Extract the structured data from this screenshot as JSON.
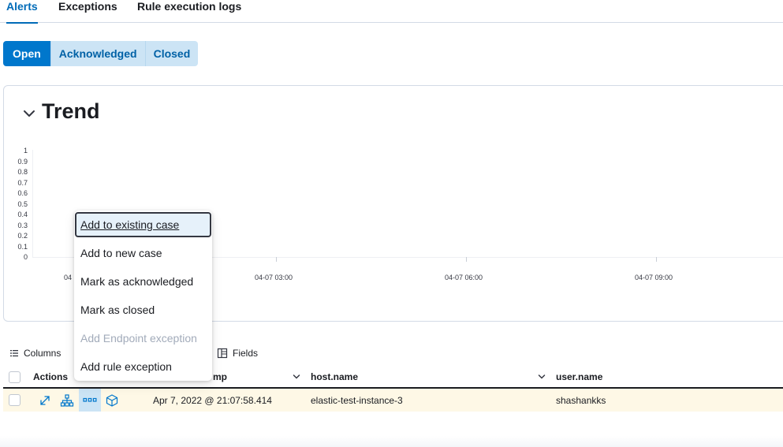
{
  "tabs": [
    {
      "label": "Alerts",
      "active": true
    },
    {
      "label": "Exceptions",
      "active": false
    },
    {
      "label": "Rule execution logs",
      "active": false
    }
  ],
  "status_filters": [
    {
      "label": "Open",
      "active": true
    },
    {
      "label": "Acknowledged",
      "active": false
    },
    {
      "label": "Closed",
      "active": false
    }
  ],
  "trend": {
    "title": "Trend"
  },
  "chart_data": {
    "type": "bar",
    "title": "",
    "xlabel": "",
    "ylabel": "",
    "ylim": [
      0,
      1
    ],
    "y_ticks": [
      "1",
      "0.9",
      "0.8",
      "0.7",
      "0.6",
      "0.5",
      "0.4",
      "0.3",
      "0.2",
      "0.1",
      "0"
    ],
    "x_ticks": [
      "04-07 00:00",
      "04-07 03:00",
      "04-07 06:00",
      "04-07 09:00"
    ],
    "x_ticks_visible_text": [
      "04",
      "04-07 03:00",
      "04-07 06:00",
      "04-07 09:00"
    ],
    "series": []
  },
  "toolbar": {
    "columns_label": "Columns",
    "fields_label": "Fields"
  },
  "table": {
    "headers": {
      "actions": "Actions",
      "timestamp": "mp",
      "host": "host.name",
      "user": "user.name"
    },
    "rows": [
      {
        "timestamp": "Apr 7, 2022 @ 21:07:58.414",
        "host": "elastic-test-instance-3",
        "user": "shashankks"
      }
    ]
  },
  "menu": {
    "items": [
      {
        "label": "Add to existing case",
        "state": "focused"
      },
      {
        "label": "Add to new case",
        "state": "normal"
      },
      {
        "label": "Mark as acknowledged",
        "state": "normal"
      },
      {
        "label": "Mark as closed",
        "state": "normal"
      },
      {
        "label": "Add Endpoint exception",
        "state": "disabled"
      },
      {
        "label": "Add rule exception",
        "state": "normal"
      }
    ]
  },
  "colors": {
    "primary": "#0077cc",
    "primary_text": "#006bb8",
    "row_highlight": "#fef8e6",
    "disabled_text": "#a2abba"
  }
}
